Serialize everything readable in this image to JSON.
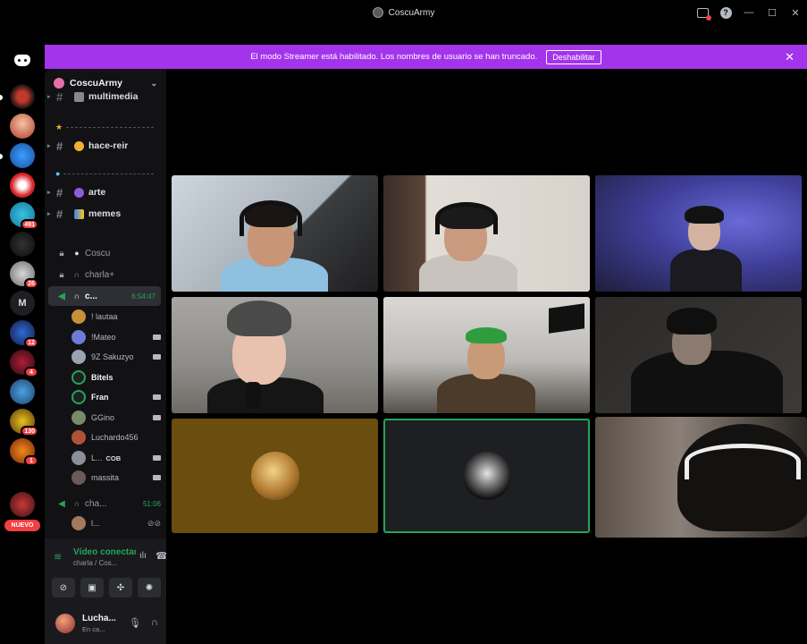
{
  "window": {
    "title": "CoscuArmy"
  },
  "banner": {
    "text": "El modo Streamer está habilitado. Los nombres de usuario se han truncado.",
    "button": "Deshabilitar"
  },
  "guilds": {
    "badges": [
      "491",
      "26",
      "12",
      "4",
      "130",
      "1"
    ],
    "letter": "M",
    "new_label": "NUEVO"
  },
  "server": {
    "name": "CoscuArmy"
  },
  "channels": [
    {
      "name": "multimedia"
    },
    {
      "name": "hace-reir"
    },
    {
      "name": "arte"
    },
    {
      "name": "memes"
    }
  ],
  "voice_channels": [
    {
      "name": "Coscu"
    },
    {
      "name": "charla+"
    },
    {
      "name": "c...",
      "timer": "6:54:47"
    },
    {
      "name": "cha...",
      "timer": "51:06"
    },
    {
      "name": "l..."
    }
  ],
  "voice_users": [
    {
      "name": "! lautaa"
    },
    {
      "name": "!Mateo"
    },
    {
      "name": "9Z Sakuzyo"
    },
    {
      "name": "Bitels"
    },
    {
      "name": "Fran"
    },
    {
      "name": "GGino"
    },
    {
      "name": "Luchardo456"
    },
    {
      "name": "L...",
      "tag": "COB"
    },
    {
      "name": "massita"
    }
  ],
  "panel": {
    "status": "Vídeo conectado",
    "channel": "charla / Cos...",
    "user_name": "Lucha...",
    "user_status": "En ca..."
  },
  "colors": {
    "accent_streamer": "#a334ec",
    "speaking": "#23a55a",
    "danger": "#f23f43"
  }
}
